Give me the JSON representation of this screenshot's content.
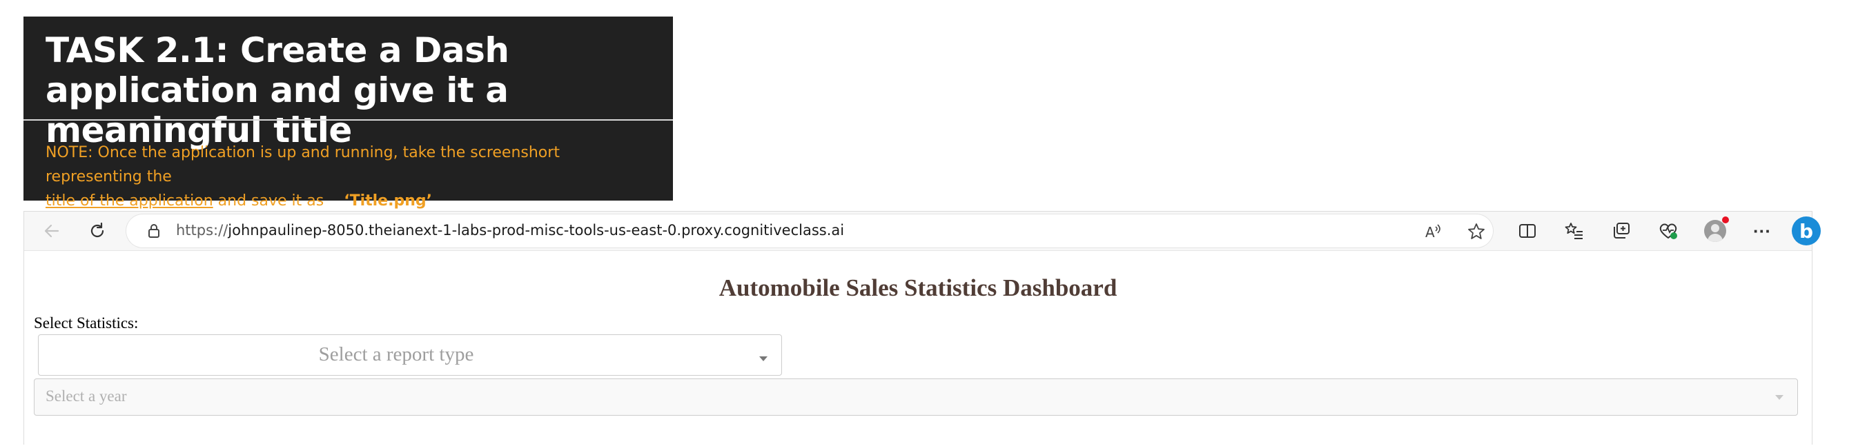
{
  "task": {
    "title": "TASK 2.1: Create a Dash application and give it a meaningful title",
    "note_prefix": "NOTE: Once the application is up and running, take the screenshort representing the",
    "note_link": "title of the application",
    "note_middle": "and save it as",
    "note_file": "‘Title.png’"
  },
  "browser": {
    "url_scheme": "https://",
    "url_host": "johnpaulinep-8050.theianext-1-labs-prod-misc-tools-us-east-0.proxy.cognitiveclass.ai",
    "icons": [
      "back-icon",
      "refresh-icon",
      "lock-icon",
      "read-aloud-icon",
      "favorite-star-icon",
      "split-screen-icon",
      "favorites-list-icon",
      "collections-icon",
      "browser-essentials-icon",
      "profile-avatar-icon",
      "more-icon",
      "bing-copilot-icon"
    ],
    "read_aloud_label": "A",
    "more_label": "···",
    "bing_label": "b"
  },
  "dashboard": {
    "title": "Automobile Sales Statistics Dashboard",
    "select_label": "Select Statistics:",
    "report_placeholder": "Select a report type",
    "year_placeholder": "Select a year"
  },
  "colors": {
    "banner_bg": "#212121",
    "note_text": "#f0a024",
    "dash_title": "#503d36"
  }
}
